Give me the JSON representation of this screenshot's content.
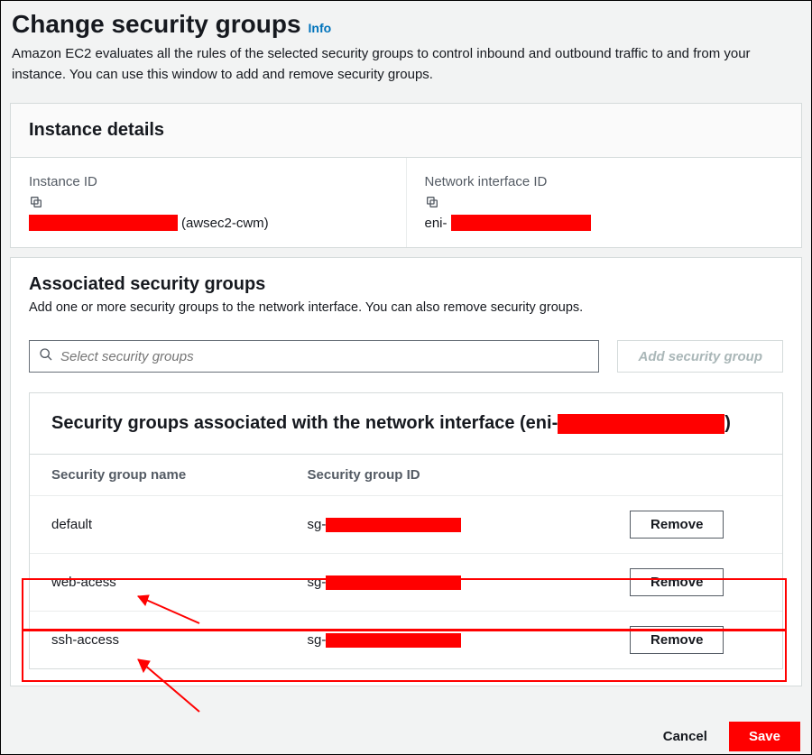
{
  "header": {
    "title": "Change security groups",
    "info_label": "Info",
    "subtitle": "Amazon EC2 evaluates all the rules of the selected security groups to control inbound and outbound traffic to and from your instance. You can use this window to add and remove security groups."
  },
  "instance_panel": {
    "title": "Instance details",
    "instance_id_label": "Instance ID",
    "instance_id_suffix": "(awsec2-cwm)",
    "eni_label": "Network interface ID",
    "eni_prefix": "eni-"
  },
  "assoc_panel": {
    "title": "Associated security groups",
    "subtitle": "Add one or more security groups to the network interface. You can also remove security groups.",
    "search_placeholder": "Select security groups",
    "add_label": "Add security group",
    "inner_title_prefix": "Security groups associated with the network interface (eni-",
    "inner_title_suffix": ")",
    "col_name": "Security group name",
    "col_id": "Security group ID",
    "rows": [
      {
        "name": "default",
        "id_prefix": "sg-",
        "remove": "Remove"
      },
      {
        "name": "web-acess",
        "id_prefix": "sg-",
        "remove": "Remove"
      },
      {
        "name": "ssh-access",
        "id_prefix": "sg-",
        "remove": "Remove"
      }
    ]
  },
  "footer": {
    "cancel": "Cancel",
    "save": "Save"
  }
}
